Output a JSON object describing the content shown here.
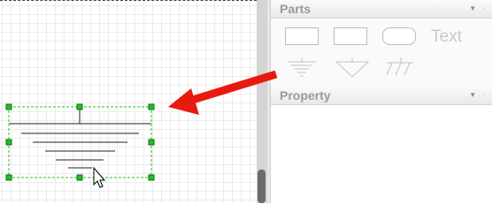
{
  "panels": {
    "parts": {
      "title": "Parts",
      "caret": "▼",
      "dot": "·"
    },
    "property": {
      "title": "Property",
      "caret": "▼",
      "dot": "·"
    }
  },
  "shapes": {
    "text_label": "Text",
    "items": [
      "rectangle",
      "rectangle-wide",
      "rounded-rectangle",
      "text",
      "earth-ground",
      "signal-ground",
      "chassis-ground"
    ]
  },
  "colors": {
    "arrow": "#e8190f",
    "selection": "#2abf2a",
    "handle": "#21c021"
  }
}
